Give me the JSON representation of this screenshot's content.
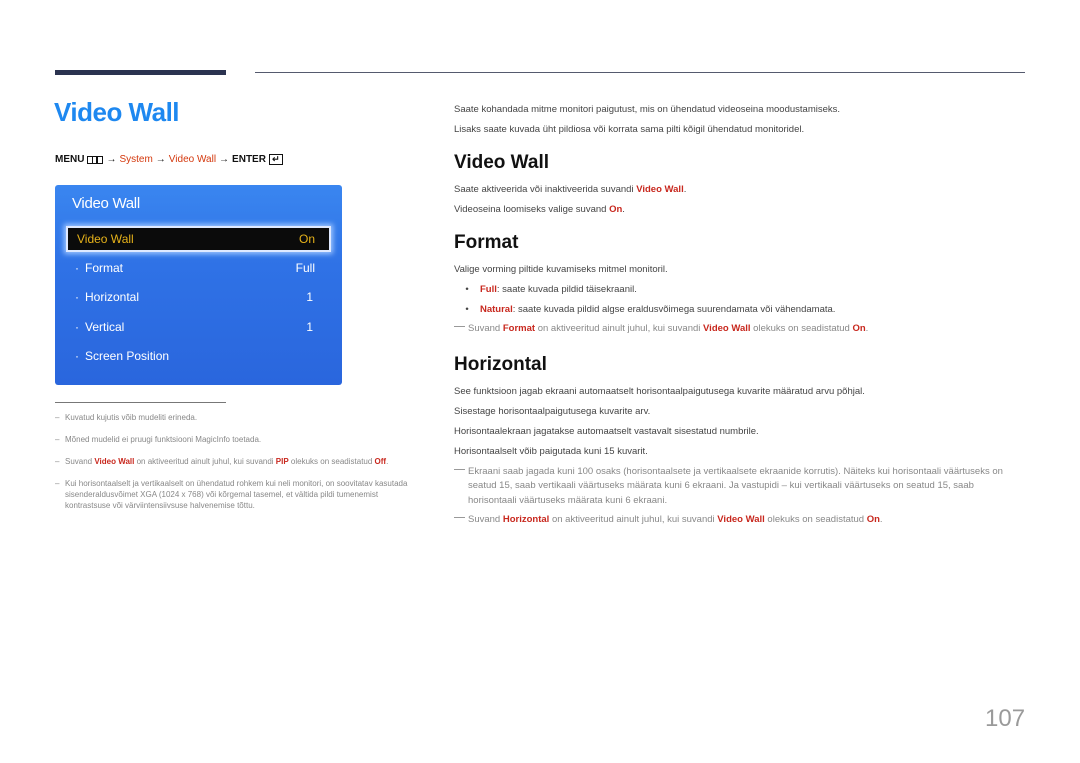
{
  "page_title": "Video Wall",
  "menu_path": {
    "menu": "MENU",
    "arrow": "→",
    "system": "System",
    "video_wall": "Video Wall",
    "enter": "ENTER",
    "enter_glyph": "↵"
  },
  "osd": {
    "title": "Video Wall",
    "selected": {
      "label": "Video Wall",
      "value": "On"
    },
    "rows": [
      {
        "label": "Format",
        "value": "Full"
      },
      {
        "label": "Horizontal",
        "value": "1"
      },
      {
        "label": "Vertical",
        "value": "1"
      },
      {
        "label": "Screen Position",
        "value": ""
      }
    ],
    "dot": "·"
  },
  "left_notes": {
    "dash": "–",
    "n1": "Kuvatud kujutis võib mudeliti erineda.",
    "n2": "Mõned mudelid ei pruugi funktsiooni MagicInfo toetada.",
    "n3": {
      "a": "Suvand ",
      "b": "Video Wall",
      "c": " on aktiveeritud ainult juhul, kui suvandi ",
      "d": "PIP",
      "e": " olekuks on seadistatud ",
      "f": "Off",
      "g": "."
    },
    "n4": "Kui horisontaalselt ja vertikaalselt on ühendatud rohkem kui neli monitori, on soovitatav kasutada sisenderaldusvõimet XGA (1024 x 768) või kõrgemal tasemel, et vältida pildi tumenemist kontrastsuse või värviintensiivsuse halvenemise tõttu."
  },
  "intro": {
    "l1": "Saate kohandada mitme monitori paigutust, mis on ühendatud videoseina moodustamiseks.",
    "l2": "Lisaks saate kuvada üht pildiosa või korrata sama pilti kõigil ühendatud monitoridel."
  },
  "sec_videowall": {
    "heading": "Video Wall",
    "p1": {
      "a": "Saate aktiveerida või inaktiveerida suvandi ",
      "b": "Video Wall",
      "c": "."
    },
    "p2": {
      "a": "Videoseina loomiseks valige suvand ",
      "b": "On",
      "c": "."
    }
  },
  "sec_format": {
    "heading": "Format",
    "p1": "Valige vorming piltide kuvamiseks mitmel monitoril.",
    "bullet": "•",
    "b1": {
      "a": "Full",
      "b": ": saate kuvada pildid täisekraanil."
    },
    "b2": {
      "a": "Natural",
      "b": ": saate kuvada pildid algse eraldusvõimega suurendamata või vähendamata."
    },
    "note": {
      "a": "Suvand ",
      "b": "Format",
      "c": " on aktiveeritud ainult juhul, kui suvandi ",
      "d": "Video Wall",
      "e": " olekuks on seadistatud ",
      "f": "On",
      "g": "."
    }
  },
  "sec_horizontal": {
    "heading": "Horizontal",
    "p1": "See funktsioon jagab ekraani automaatselt horisontaalpaigutusega kuvarite määratud arvu põhjal.",
    "p2": "Sisestage horisontaalpaigutusega kuvarite arv.",
    "p3": "Horisontaalekraan jagatakse automaatselt vastavalt sisestatud numbrile.",
    "p4": "Horisontaalselt võib paigutada kuni 15 kuvarit.",
    "note1": "Ekraani saab jagada kuni 100 osaks (horisontaalsete ja vertikaalsete ekraanide korrutis). Näiteks kui horisontaali väärtuseks on seatud 15, saab vertikaali väärtuseks määrata kuni 6 ekraani. Ja vastupidi – kui vertikaali väärtuseks on seatud 15, saab horisontaali väärtuseks määrata kuni 6 ekraani.",
    "note2": {
      "a": "Suvand ",
      "b": "Horizontal",
      "c": " on aktiveeritud ainult juhul, kui suvandi ",
      "d": "Video Wall",
      "e": " olekuks on seadistatud ",
      "f": "On",
      "g": "."
    }
  },
  "page_number": "107"
}
